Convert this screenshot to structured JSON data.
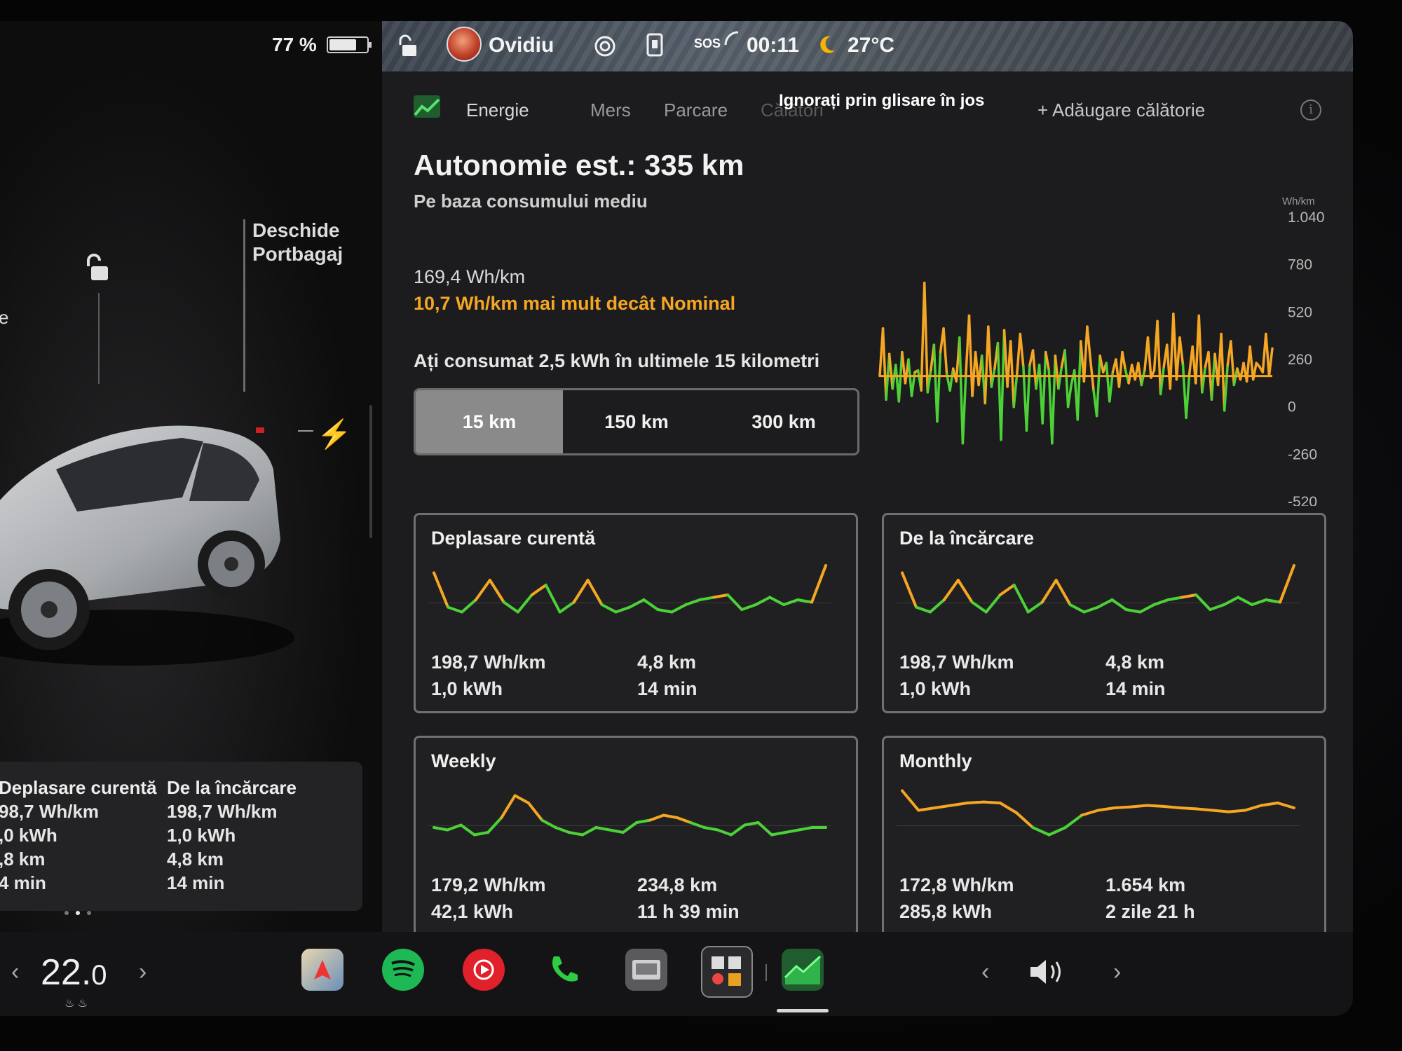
{
  "status": {
    "battery_percent": "77 %",
    "battery_level": 0.77,
    "profile_name": "Ovidiu",
    "time": "00:11",
    "temperature": "27°C",
    "sos_label": "SOS"
  },
  "car": {
    "trunk_label_line1": "Deschide",
    "trunk_label_line2": "Portbagaj",
    "left_edge_letter": "e"
  },
  "mini_stats": {
    "current": {
      "title": "Deplasare curentă",
      "rate": "98,7 Wh/km",
      "energy": ",0 kWh",
      "distance": ",8 km",
      "time": "4 min"
    },
    "charge": {
      "title": "De la încărcare",
      "rate": "198,7 Wh/km",
      "energy": "1,0 kWh",
      "distance": "4,8 km",
      "time": "14 min"
    }
  },
  "tabs": {
    "energy": "Energie",
    "drive": "Mers",
    "park": "Parcare",
    "trips": "Călători",
    "add_trip": "+ Adăugare călătorie",
    "overlay_hint": "Ignorați prin glisare în jos"
  },
  "range": {
    "title": "Autonomie est.: 335 km",
    "subtitle": "Pe baza consumului mediu",
    "avg_consumption": "169,4 Wh/km",
    "vs_nominal": "10,7 Wh/km mai mult decât Nominal",
    "consumed_text": "Ați consumat 2,5 kWh în ultimele 15 kilometri"
  },
  "distance_segments": {
    "options": [
      "15 km",
      "150 km",
      "300 km"
    ],
    "selected": "15 km"
  },
  "chart_data": {
    "type": "line",
    "ylabel": "Wh/km",
    "ylim": [
      -520,
      1040
    ],
    "yticks": [
      "1.040",
      "780",
      "520",
      "260",
      "0",
      "-260",
      "-520"
    ],
    "baseline": 169,
    "colors": {
      "above": "#f5a623",
      "below": "#4cd137"
    },
    "values": [
      170,
      430,
      40,
      290,
      100,
      230,
      30,
      300,
      130,
      260,
      60,
      190,
      200,
      90,
      680,
      80,
      200,
      340,
      -80,
      300,
      430,
      180,
      90,
      210,
      140,
      380,
      -200,
      180,
      500,
      60,
      300,
      120,
      280,
      20,
      440,
      110,
      210,
      350,
      -180,
      420,
      110,
      360,
      0,
      180,
      400,
      220,
      -130,
      230,
      310,
      100,
      230,
      -90,
      300,
      200,
      -200,
      280,
      100,
      220,
      310,
      0,
      120,
      200,
      -70,
      360,
      140,
      440,
      260,
      90,
      -50,
      280,
      190,
      240,
      30,
      190,
      260,
      110,
      300,
      200,
      130,
      230,
      150,
      240,
      120,
      200,
      380,
      160,
      200,
      470,
      70,
      220,
      340,
      100,
      510,
      150,
      380,
      230,
      -60,
      180,
      330,
      130,
      500,
      80,
      220,
      300,
      40,
      290,
      120,
      400,
      -20,
      230,
      360,
      120,
      210,
      150,
      240,
      140,
      330,
      150,
      240,
      220,
      190,
      400,
      170,
      320
    ]
  },
  "cards": {
    "current": {
      "title": "Deplasare curentă",
      "rate": "198,7 Wh/km",
      "energy": "1,0 kWh",
      "distance": "4,8 km",
      "time": "14 min",
      "trend": [
        0.85,
        0.15,
        0.05,
        0.3,
        0.7,
        0.25,
        0.05,
        0.4,
        0.6,
        0.05,
        0.25,
        0.7,
        0.2,
        0.05,
        0.15,
        0.3,
        0.1,
        0.05,
        0.2,
        0.3,
        0.35,
        0.4,
        0.1,
        0.2,
        0.35,
        0.2,
        0.3,
        0.25,
        1.0
      ]
    },
    "charge": {
      "title": "De la încărcare",
      "rate": "198,7 Wh/km",
      "energy": "1,0 kWh",
      "distance": "4,8 km",
      "time": "14 min",
      "trend": [
        0.85,
        0.15,
        0.05,
        0.3,
        0.7,
        0.25,
        0.05,
        0.4,
        0.6,
        0.05,
        0.25,
        0.7,
        0.2,
        0.05,
        0.15,
        0.3,
        0.1,
        0.05,
        0.2,
        0.3,
        0.35,
        0.4,
        0.1,
        0.2,
        0.35,
        0.2,
        0.3,
        0.25,
        1.0
      ]
    },
    "weekly": {
      "title": "Weekly",
      "rate": "179,2 Wh/km",
      "energy": "42,1 kWh",
      "distance": "234,8 km",
      "time": "11 h 39 min",
      "trend": [
        0.2,
        0.15,
        0.25,
        0.05,
        0.1,
        0.4,
        0.85,
        0.7,
        0.35,
        0.2,
        0.1,
        0.05,
        0.2,
        0.15,
        0.1,
        0.3,
        0.35,
        0.45,
        0.4,
        0.3,
        0.2,
        0.15,
        0.05,
        0.25,
        0.3,
        0.05,
        0.1,
        0.15,
        0.2,
        0.2
      ]
    },
    "monthly": {
      "title": "Monthly",
      "rate": "172,8 Wh/km",
      "energy": "285,8 kWh",
      "distance": "1.654 km",
      "time": "2 zile 21 h",
      "trend": [
        0.95,
        0.55,
        0.6,
        0.65,
        0.7,
        0.72,
        0.7,
        0.5,
        0.2,
        0.05,
        0.2,
        0.45,
        0.55,
        0.6,
        0.62,
        0.65,
        0.63,
        0.6,
        0.58,
        0.55,
        0.52,
        0.55,
        0.65,
        0.7,
        0.6
      ]
    }
  },
  "dock": {
    "temperature_int": "22.",
    "temperature_dec": "0"
  }
}
